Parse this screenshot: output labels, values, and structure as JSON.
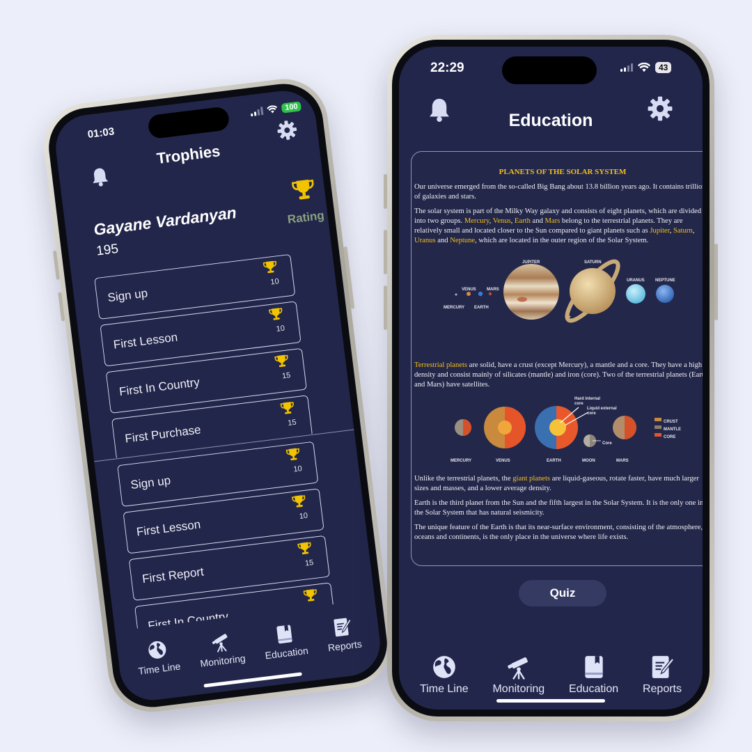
{
  "trophies_screen": {
    "status": {
      "time": "01:03",
      "battery": "100"
    },
    "title": "Trophies",
    "user": {
      "name": "Gayane Vardanyan",
      "score": "195"
    },
    "rating_label": "Rating",
    "list_top": [
      {
        "name": "Sign up",
        "points": "10"
      },
      {
        "name": "First Lesson",
        "points": "10"
      },
      {
        "name": "First In Country",
        "points": "15"
      },
      {
        "name": "First Purchase",
        "points": "15"
      }
    ],
    "list_bottom": [
      {
        "name": "Sign up",
        "points": "10"
      },
      {
        "name": "First Lesson",
        "points": "10"
      },
      {
        "name": "First Report",
        "points": "15"
      },
      {
        "name": "First In Country",
        "points": ""
      }
    ],
    "tabs": [
      "Time Line",
      "Monitoring",
      "Education",
      "Reports"
    ]
  },
  "education_screen": {
    "status": {
      "time": "22:29",
      "battery": "43"
    },
    "title": "Education",
    "article": {
      "title": "PLANETS OF THE SOLAR SYSTEM",
      "p1": "Our universe emerged from the so-called Big Bang about 13.8 billion years ago. It contains trillions of galaxies and stars.",
      "p2": {
        "a": "The solar system is part of the Milky Way galaxy and consists of eight planets, which are divided into two groups. ",
        "mercury": "Mercury",
        "venus": "Venus",
        "earth": "Earth",
        "and": "and",
        "mars": "Mars",
        "b": " belong to the terrestrial planets. They are relatively small and located closer to the Sun compared to giant planets such as ",
        "jupiter": "Jupiter",
        "saturn": "Saturn",
        "uranus": "Uranus",
        "neptune": "Neptune",
        "c": ", which are located in the outer region of the Solar System."
      },
      "figure1_labels": {
        "mercury": "MERCURY",
        "venus": "VENUS",
        "earth": "EARTH",
        "mars": "MARS",
        "jupiter": "JUPITER",
        "saturn": "SATURN",
        "uranus": "URANUS",
        "neptune": "NEPTUNE"
      },
      "p3": {
        "hl": "Terrestrial planets",
        "rest": " are solid, have a crust (except Mercury), a mantle and a core. They have a high density and consist mainly of silicates (mantle) and iron (core). Two of the terrestrial planets (Earth and Mars) have satellites."
      },
      "figure2_labels": {
        "mercury": "MERCURY",
        "venus": "VENUS",
        "earth": "EARTH",
        "moon": "MOON",
        "mars": "MARS",
        "hard_core": "Hard internal core",
        "liquid_core": "Liquid external core",
        "core": "Core",
        "crust": "CRUST",
        "mantle": "MANTLE",
        "core_legend": "CORE"
      },
      "p4": {
        "a": "Unlike the terrestrial planets, the ",
        "hl": "giant planets",
        "b": " are liquid-gaseous, rotate faster, have much larger sizes and masses, and a lower average density."
      },
      "p5": "Earth is the third planet from the Sun and the fifth largest in the Solar System. It is the only one in the Solar System that has natural seismicity.",
      "p6": "The unique feature of the Earth is that its near-surface environment, consisting of the atmosphere, oceans and continents, is the only place in the universe where life exists."
    },
    "quiz_label": "Quiz",
    "tabs": [
      "Time Line",
      "Monitoring",
      "Education",
      "Reports"
    ]
  },
  "colors": {
    "background": "#eceef9",
    "screen": "#22264b",
    "accent": "#f4c021",
    "trophy": "#f2c300",
    "rating": "#8aa07e",
    "battery_green": "#2fc04e"
  },
  "icons": [
    "bell-icon",
    "gear-icon",
    "trophy-icon",
    "globe-icon",
    "telescope-icon",
    "book-icon",
    "report-icon",
    "wifi-icon",
    "signal-icon"
  ]
}
